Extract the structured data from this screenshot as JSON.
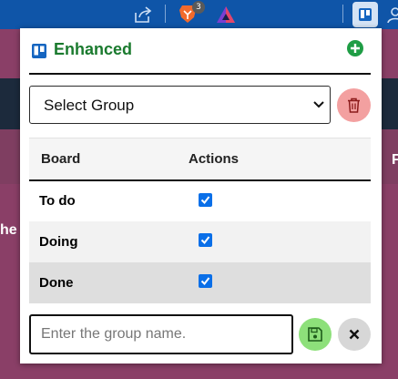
{
  "browser": {
    "extension_badge_count": "3",
    "icons": [
      "share-icon",
      "brave-lion-icon",
      "brave-rewards-icon",
      "trello-extension-icon",
      "profile-icon"
    ]
  },
  "background_page": {
    "right_fragment": "F",
    "left_fragment": "he"
  },
  "popup": {
    "title": "Enhanced",
    "brand_color": "#1a7a2e",
    "group_select": {
      "selected": "Select Group",
      "options": [
        "Select Group"
      ]
    },
    "table": {
      "headers": [
        "Board",
        "Actions"
      ],
      "rows": [
        {
          "board": "To do",
          "checked": true
        },
        {
          "board": "Doing",
          "checked": true
        },
        {
          "board": "Done",
          "checked": true
        }
      ]
    },
    "group_name_placeholder": "Enter the group name.",
    "colors": {
      "add": "#1f9d45",
      "delete": "#f3a0a0",
      "save": "#8de07a",
      "cancel": "#d7d7d7",
      "checkbox": "#0a6fe8"
    }
  }
}
